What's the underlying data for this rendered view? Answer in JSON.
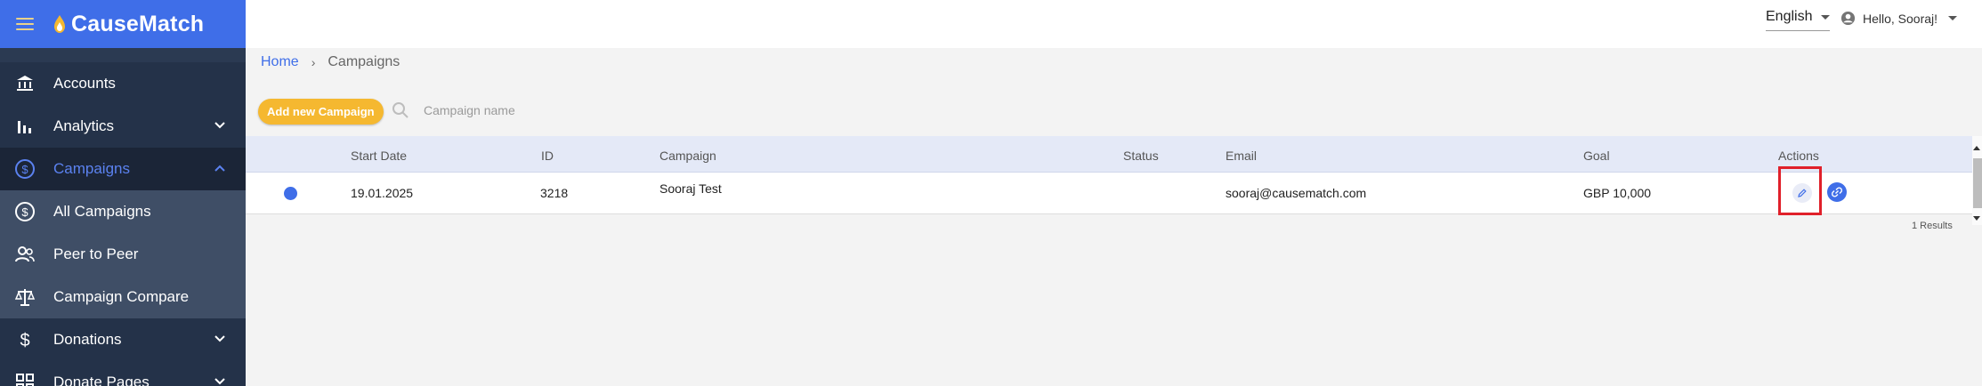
{
  "app": {
    "brand": "CauseMatch"
  },
  "sidebar": {
    "items": [
      {
        "label": "Accounts",
        "icon": "bank-icon"
      },
      {
        "label": "Analytics",
        "icon": "bar-chart-icon",
        "expandable": true
      },
      {
        "label": "Campaigns",
        "icon": "dollar-circle-icon",
        "expanded": true,
        "active": true
      },
      {
        "label": "All Campaigns",
        "icon": "dollar-circle-icon"
      },
      {
        "label": "Peer to Peer",
        "icon": "people-icon"
      },
      {
        "label": "Campaign Compare",
        "icon": "scale-icon"
      },
      {
        "label": "Donations",
        "icon": "dollar-icon",
        "expandable": true
      },
      {
        "label": "Donate Pages",
        "icon": "grid-icon",
        "expandable": true
      }
    ]
  },
  "topbar": {
    "language": "English",
    "greeting": "Hello, Sooraj!"
  },
  "breadcrumb": {
    "home": "Home",
    "current": "Campaigns"
  },
  "toolbar": {
    "add_label": "Add new Campaign",
    "search_placeholder": "Campaign name"
  },
  "table": {
    "headers": [
      "Start Date",
      "ID",
      "Campaign",
      "Status",
      "Email",
      "Goal",
      "Actions"
    ],
    "rows": [
      {
        "start_date": "19.01.2025",
        "id": "3218",
        "campaign": "Sooraj Test",
        "status": "",
        "email": "sooraj@causematch.com",
        "goal": "GBP 10,000"
      }
    ],
    "results": "1 Results"
  },
  "colors": {
    "accent": "#3f6ee8",
    "sidebar": "#2b3a52",
    "button": "#f5b830",
    "highlight": "#e0202a"
  }
}
